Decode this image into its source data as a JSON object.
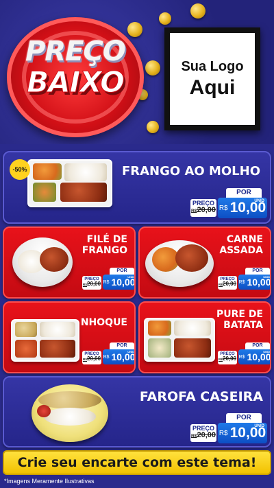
{
  "header": {
    "headline_line1": "PREÇO",
    "headline_line2": "BAIXO",
    "logo_line1": "Sua Logo",
    "logo_line2": "Aqui"
  },
  "products": [
    {
      "name_lines": [
        "FRANGO AO MOLHO"
      ],
      "badge": "-50%",
      "por": "POR",
      "old_label": "PREÇO",
      "old_prefix": "R$",
      "old_value": "20,00",
      "currency": "R$",
      "price": "10,00",
      "unit": "UNID"
    },
    {
      "name_lines": [
        "FILÉ DE",
        "FRANGO"
      ],
      "por": "POR",
      "old_label": "PREÇO",
      "old_prefix": "R$",
      "old_value": "20,00",
      "currency": "R$",
      "price": "10,00",
      "unit": "UNID"
    },
    {
      "name_lines": [
        "CARNE",
        "ASSADA"
      ],
      "por": "POR",
      "old_label": "PREÇO",
      "old_prefix": "R$",
      "old_value": "20,00",
      "currency": "R$",
      "price": "10,00",
      "unit": "UNID"
    },
    {
      "name_lines": [
        "NHOQUE"
      ],
      "por": "POR",
      "old_label": "PREÇO",
      "old_prefix": "R$",
      "old_value": "20,00",
      "currency": "R$",
      "price": "10,00",
      "unit": "UNID"
    },
    {
      "name_lines": [
        "PURE DE",
        "BATATA"
      ],
      "por": "POR",
      "old_label": "PREÇO",
      "old_prefix": "R$",
      "old_value": "20,00",
      "currency": "R$",
      "price": "10,00",
      "unit": "UNID"
    },
    {
      "name_lines": [
        "FAROFA CASEIRA"
      ],
      "por": "POR",
      "old_label": "PREÇO",
      "old_prefix": "R$",
      "old_value": "20,00",
      "currency": "R$",
      "price": "10,00",
      "unit": "UNID"
    }
  ],
  "footer": {
    "cta": "Crie seu encarte com este tema!",
    "disclaimer": "*Imagens Meramente Ilustrativas"
  },
  "colors": {
    "background_blue": "#2a2a8c",
    "card_red": "#e8121a",
    "price_blue": "#0d4fc4",
    "cta_yellow": "#ffe23d"
  }
}
